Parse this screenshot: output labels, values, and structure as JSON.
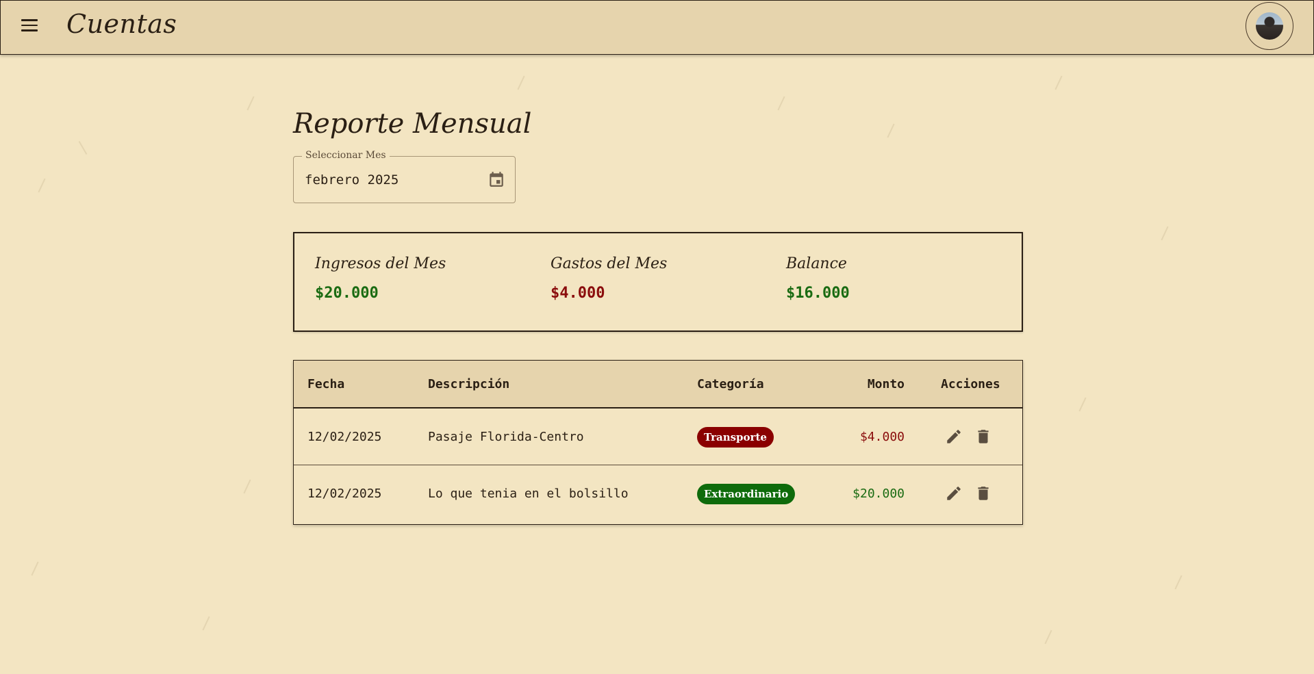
{
  "app": {
    "title": "Cuentas"
  },
  "icons": {
    "menu": "menu-icon",
    "avatar": "user-avatar",
    "calendar": "calendar-icon",
    "edit": "pencil-icon",
    "delete": "trash-icon"
  },
  "page": {
    "title": "Reporte Mensual"
  },
  "month_picker": {
    "label": "Seleccionar Mes",
    "value": "febrero 2025"
  },
  "summary": {
    "income": {
      "label": "Ingresos del Mes",
      "value": "$20.000"
    },
    "expenses": {
      "label": "Gastos del Mes",
      "value": "$4.000"
    },
    "balance": {
      "label": "Balance",
      "value": "$16.000"
    }
  },
  "table": {
    "headers": {
      "date": "Fecha",
      "description": "Descripción",
      "category": "Categoría",
      "amount": "Monto",
      "actions": "Acciones"
    },
    "rows": [
      {
        "date": "12/02/2025",
        "description": "Pasaje Florida-Centro",
        "category": "Transporte",
        "amount": "$4.000",
        "type": "expense"
      },
      {
        "date": "12/02/2025",
        "description": "Lo que tenia en el bolsillo",
        "category": "Extraordinario",
        "amount": "$20.000",
        "type": "income"
      }
    ]
  },
  "colors": {
    "income": "#1a6b12",
    "expense": "#8a0c0c",
    "background": "#f3e5c2",
    "header": "#e6d4ad"
  }
}
